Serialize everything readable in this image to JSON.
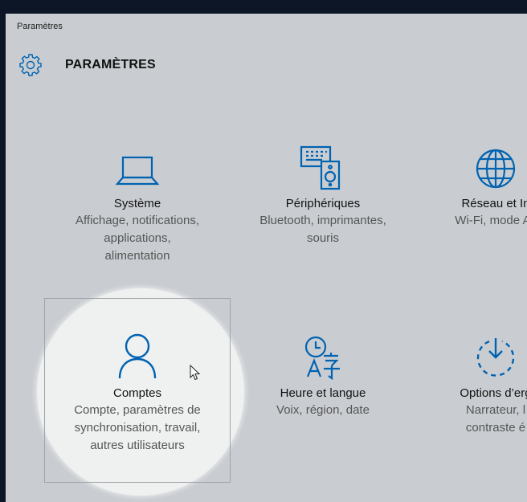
{
  "window": {
    "title": "Paramètres"
  },
  "header": {
    "icon": "gear-icon",
    "title": "PARAMÈTRES"
  },
  "accent": "#0063b1",
  "tiles": [
    {
      "icon": "laptop-icon",
      "name": "Système",
      "desc": [
        "Affichage, notifications,",
        "applications,",
        "alimentation"
      ]
    },
    {
      "icon": "devices-icon",
      "name": "Périphériques",
      "desc": [
        "Bluetooth, imprimantes,",
        "souris"
      ]
    },
    {
      "icon": "globe-icon",
      "name": "Réseau et In",
      "desc": [
        "Wi-Fi, mode Av"
      ]
    },
    {
      "icon": "person-icon",
      "name": "Comptes",
      "desc": [
        "Compte, paramètres de",
        "synchronisation, travail,",
        "autres utilisateurs"
      ]
    },
    {
      "icon": "time-language-icon",
      "name": "Heure et langue",
      "desc": [
        "Voix, région, date"
      ]
    },
    {
      "icon": "ease-of-access-icon",
      "name": "Options d’erg",
      "desc": [
        "Narrateur, l",
        "contraste é"
      ]
    }
  ]
}
